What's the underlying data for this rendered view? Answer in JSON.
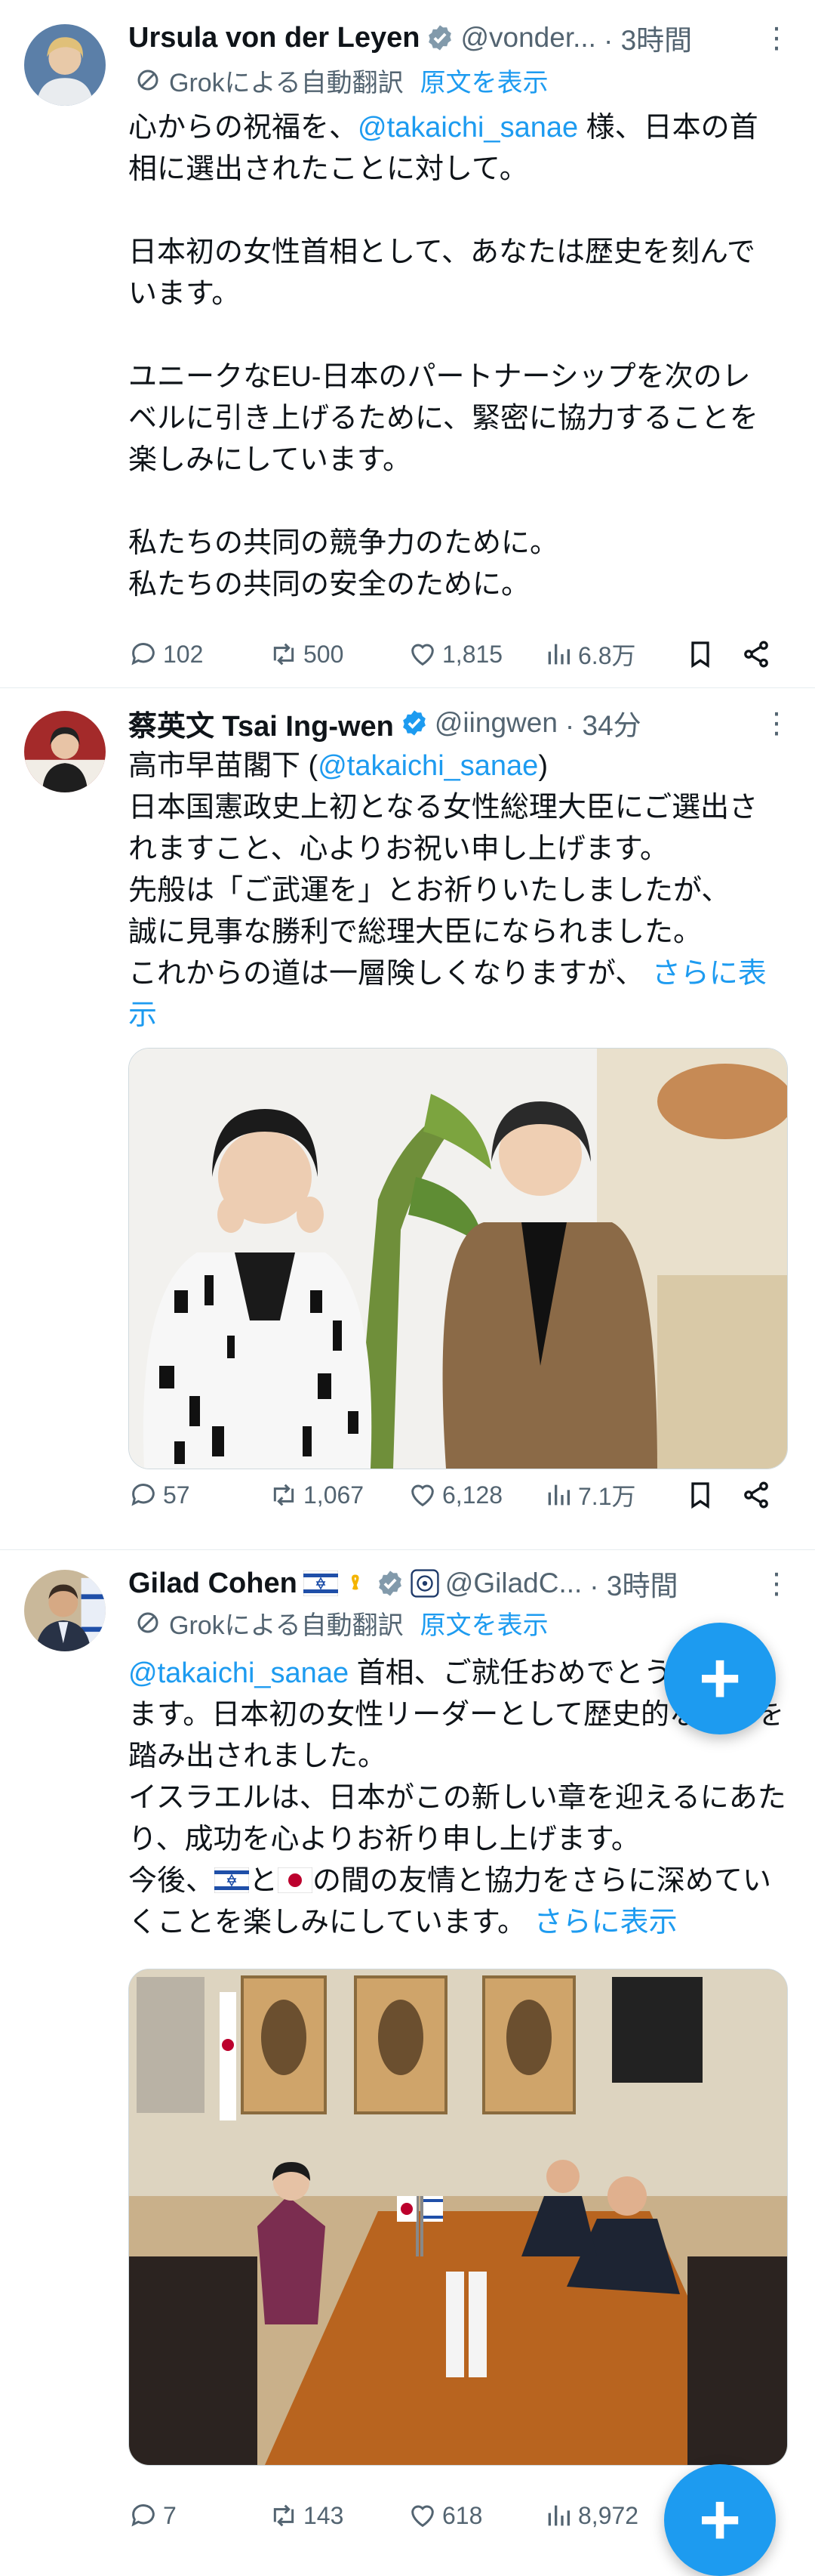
{
  "tweets": [
    {
      "name": "Ursula von der Leyen",
      "handle": "@vonder...",
      "time": "· 3時間",
      "translate_label": "Grokによる自動翻訳",
      "translate_link": "原文を表示",
      "text_pre": "心からの祝福を、",
      "mention": "@takaichi_sanae",
      "text_post": " 様、日本の首相に選出されたことに対して。\n\n日本初の女性首相として、あなたは歴史を刻んでいます。\n\nユニークなEU-日本のパートナーシップを次のレベルに引き上げるために、緊密に協力することを楽しみにしています。\n\n私たちの共同の競争力のために。\n私たちの共同の安全のために。",
      "replies": "102",
      "retweets": "500",
      "likes": "1,815",
      "views": "6.8万"
    },
    {
      "name": "蔡英文 Tsai Ing-wen",
      "handle": "@iingwen",
      "time": "· 34分",
      "text_pre": "高市早苗閣下 (",
      "mention": "@takaichi_sanae",
      "text_post": ")\n日本国憲政史上初となる女性総理大臣にご選出されますこと、心よりお祝い申し上げます。\n先般は「ご武運を」とお祈りいたしましたが、\n誠に見事な勝利で総理大臣になられました。\nこれからの道は一層険しくなりますが、 ",
      "more": "さらに表示",
      "replies": "57",
      "retweets": "1,067",
      "likes": "6,128",
      "views": "7.1万"
    },
    {
      "name": "Gilad Cohen",
      "handle": "@GiladC...",
      "time": "· 3時間",
      "translate_label": "Grokによる自動翻訳",
      "translate_link": "原文を表示",
      "mention": "@takaichi_sanae",
      "text_post": " 首相、ご就任おめでとうございます。日本初の女性リーダーとして歴史的な一歩を踏み出されました。\nイスラエルは、日本がこの新しい章を迎えるにあたり、成功を心よりお祈り申し上げます。\n今後、",
      "text_mid": "と",
      "text_end": "の間の友情と協力をさらに深めていくことを楽しみにしています。 ",
      "more": "さらに表示",
      "replies": "7",
      "retweets": "143",
      "likes": "618",
      "views": "8,972"
    }
  ],
  "colors": {
    "accent": "#1d9bf0",
    "muted": "#536471"
  }
}
